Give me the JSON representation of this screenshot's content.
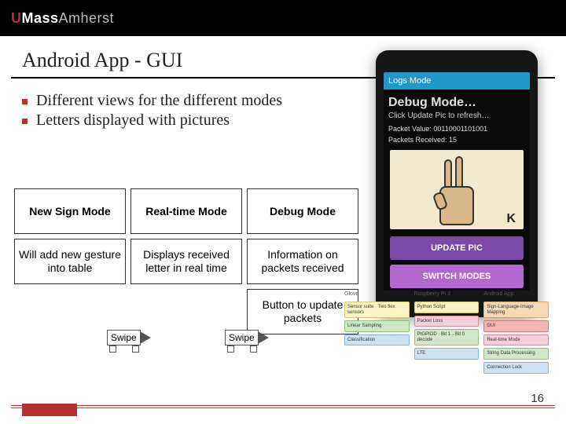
{
  "logo": {
    "u": "U",
    "mass": "Mass",
    "amherst": "Amherst"
  },
  "title": "Android App - GUI",
  "bullets": [
    "Different views for the different modes",
    "Letters displayed with pictures"
  ],
  "table": {
    "cols": [
      {
        "head": "New Sign Mode",
        "desc": "Will add new gesture into table"
      },
      {
        "head": "Real-time Mode",
        "desc": "Displays received letter in real time"
      },
      {
        "head": "Debug Mode",
        "desc": "Information on packets received",
        "extra": "Button to update packets"
      }
    ]
  },
  "swipe_label": "Swipe",
  "phone": {
    "topbar": "Logs Mode",
    "title": "Debug Mode…",
    "sub": "Click Update Pic to refresh…",
    "packet_label": "Packet Value: 00110001101001",
    "packet_received": "Packets Received: 15",
    "letter": "K",
    "btn1": "UPDATE PIC",
    "btn2": "SWITCH MODES"
  },
  "diagram": {
    "h1": "Glove",
    "h2": "Raspberry Pi 3",
    "h3": "Android App",
    "c1a": "Sensor suite · Two flex sensors",
    "c1b": "Linear Sampling",
    "c1c": "Classification",
    "c2a": "Python Script",
    "c2b": "Packet Loss",
    "c2c": "PIGPIOD · Bit 1→Bit 0 decode",
    "c2d": "LTE",
    "c3a": "Sign-Language-Image Mapping",
    "c3b": "GUI",
    "c3c": "Real-time Mode",
    "c3d": "String Data Processing",
    "c3e": "Connection Lock"
  },
  "page": "16"
}
